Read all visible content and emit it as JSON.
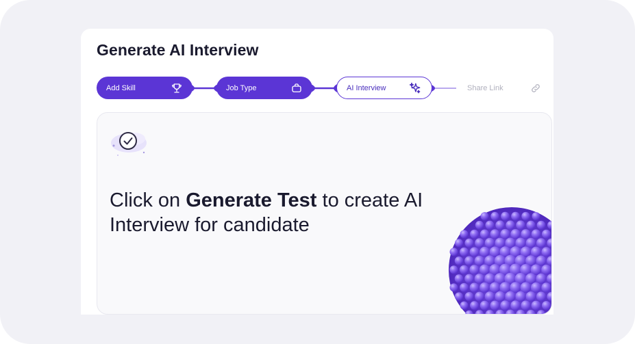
{
  "page": {
    "title": "Generate AI Interview"
  },
  "steps": [
    {
      "label": "Add Skill",
      "state": "done",
      "icon": "trophy-icon"
    },
    {
      "label": "Job Type",
      "state": "done",
      "icon": "briefcase-icon"
    },
    {
      "label": "AI Interview",
      "state": "active",
      "icon": "sparkles-icon"
    },
    {
      "label": "Share Link",
      "state": "pending",
      "icon": "link-icon"
    }
  ],
  "panel": {
    "message_prefix": "Click on ",
    "message_bold": "Generate Test",
    "message_suffix": " to create AI Interview for candidate",
    "badge_icon": "check-circle-icon",
    "illustration": "purple-sphere-illustration"
  },
  "colors": {
    "primary": "#5b35d5",
    "background": "#f1f1f6",
    "text": "#1a1a2e",
    "muted": "#b0b0bd"
  }
}
